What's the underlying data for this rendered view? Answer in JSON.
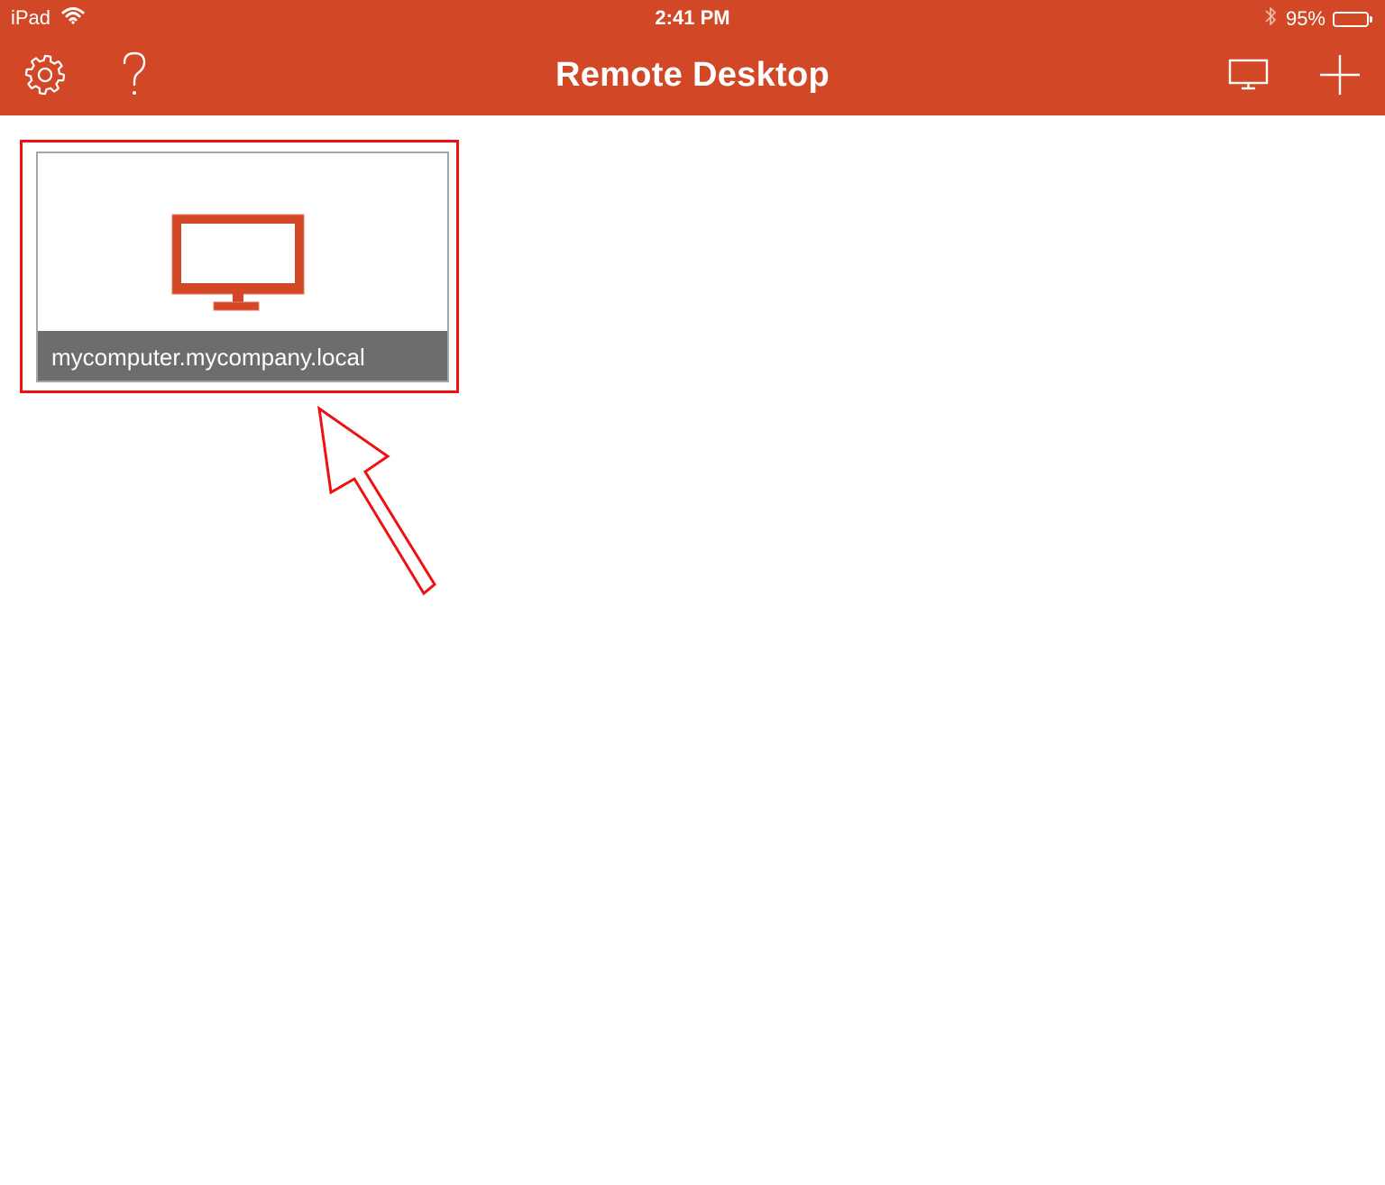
{
  "status_bar": {
    "device": "iPad",
    "time": "2:41 PM",
    "battery_percent": "95%",
    "battery_level": 0.95,
    "icons": [
      "wifi-icon",
      "bluetooth-icon",
      "battery-icon"
    ]
  },
  "nav_bar": {
    "title": "Remote Desktop",
    "left_buttons": [
      "gear-icon",
      "question-icon"
    ],
    "right_buttons": [
      "monitor-icon",
      "plus-icon"
    ]
  },
  "desktops": [
    {
      "name": "mycomputer.mycompany.local",
      "icon": "monitor-icon"
    }
  ],
  "colors": {
    "accent": "#d24726",
    "tile_label_bg": "#6d6d6d",
    "annotation": "#ee1111"
  }
}
